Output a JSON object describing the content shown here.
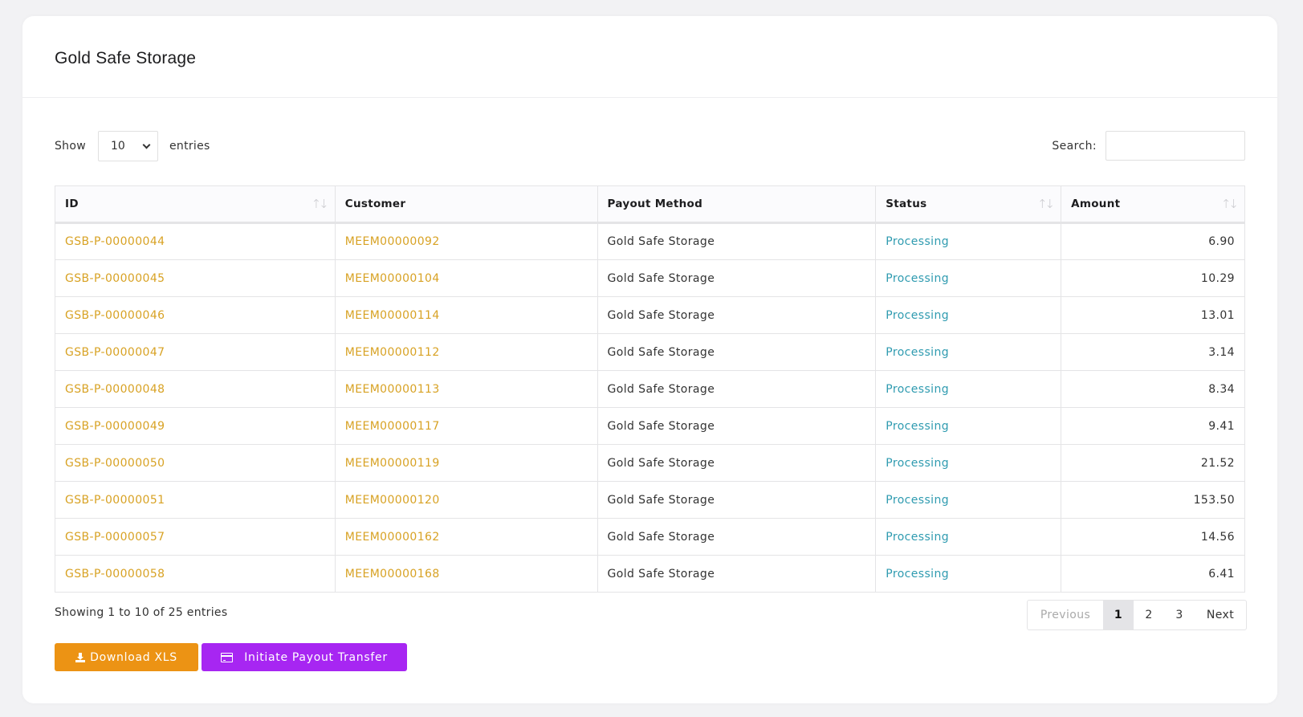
{
  "page": {
    "title": "Gold Safe Storage"
  },
  "length_menu": {
    "show_label": "Show",
    "selected": "10",
    "entries_label": "entries"
  },
  "search": {
    "label": "Search:",
    "value": "",
    "placeholder": ""
  },
  "table": {
    "columns": [
      {
        "label": "ID",
        "sortable": true
      },
      {
        "label": "Customer",
        "sortable": false
      },
      {
        "label": "Payout Method",
        "sortable": false
      },
      {
        "label": "Status",
        "sortable": true
      },
      {
        "label": "Amount",
        "sortable": true
      }
    ],
    "sort_icon": "sort-arrows-icon",
    "rows": [
      {
        "id": "GSB-P-00000044",
        "customer": "MEEM00000092",
        "method": "Gold Safe Storage",
        "status": "Processing",
        "amount": "6.90"
      },
      {
        "id": "GSB-P-00000045",
        "customer": "MEEM00000104",
        "method": "Gold Safe Storage",
        "status": "Processing",
        "amount": "10.29"
      },
      {
        "id": "GSB-P-00000046",
        "customer": "MEEM00000114",
        "method": "Gold Safe Storage",
        "status": "Processing",
        "amount": "13.01"
      },
      {
        "id": "GSB-P-00000047",
        "customer": "MEEM00000112",
        "method": "Gold Safe Storage",
        "status": "Processing",
        "amount": "3.14"
      },
      {
        "id": "GSB-P-00000048",
        "customer": "MEEM00000113",
        "method": "Gold Safe Storage",
        "status": "Processing",
        "amount": "8.34"
      },
      {
        "id": "GSB-P-00000049",
        "customer": "MEEM00000117",
        "method": "Gold Safe Storage",
        "status": "Processing",
        "amount": "9.41"
      },
      {
        "id": "GSB-P-00000050",
        "customer": "MEEM00000119",
        "method": "Gold Safe Storage",
        "status": "Processing",
        "amount": "21.52"
      },
      {
        "id": "GSB-P-00000051",
        "customer": "MEEM00000120",
        "method": "Gold Safe Storage",
        "status": "Processing",
        "amount": "153.50"
      },
      {
        "id": "GSB-P-00000057",
        "customer": "MEEM00000162",
        "method": "Gold Safe Storage",
        "status": "Processing",
        "amount": "14.56"
      },
      {
        "id": "GSB-P-00000058",
        "customer": "MEEM00000168",
        "method": "Gold Safe Storage",
        "status": "Processing",
        "amount": "6.41"
      }
    ]
  },
  "info": "Showing 1 to 10 of 25 entries",
  "pagination": {
    "previous": "Previous",
    "pages": [
      "1",
      "2",
      "3"
    ],
    "current": "1",
    "next": "Next"
  },
  "actions": {
    "download": {
      "label": "Download XLS",
      "icon": "download-icon"
    },
    "payout": {
      "label": "Initiate Payout Transfer",
      "icon": "credit-card-icon"
    }
  },
  "colors": {
    "link_gold": "#d8a224",
    "status_processing": "#2f9bb0",
    "download_btn": "#ec9314",
    "payout_btn": "#a726f2"
  }
}
